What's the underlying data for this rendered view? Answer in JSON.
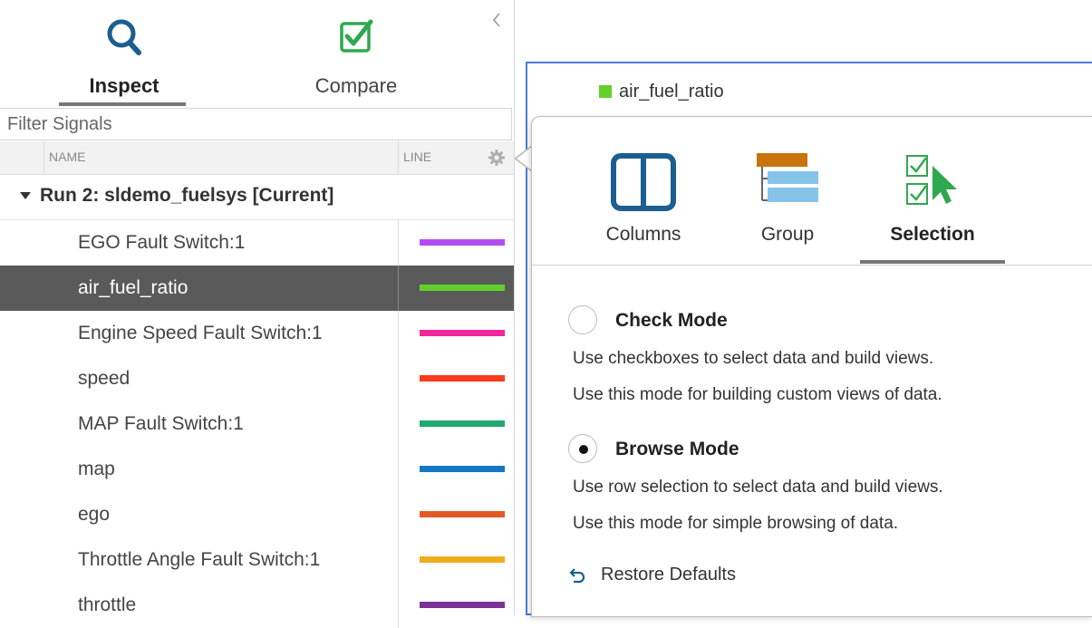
{
  "left_panel": {
    "tabs": [
      {
        "label": "Inspect",
        "icon": "search-icon",
        "active": true
      },
      {
        "label": "Compare",
        "icon": "check-square-icon",
        "active": false
      }
    ],
    "filter": {
      "placeholder": "Filter Signals",
      "value": ""
    },
    "columns": {
      "name": "NAME",
      "line": "LINE"
    },
    "run": {
      "label": "Run 2: sldemo_fuelsys [Current]",
      "expanded": true
    },
    "signals": [
      {
        "name": "EGO Fault Switch:1",
        "color": "#b44cf5",
        "selected": false
      },
      {
        "name": "air_fuel_ratio",
        "color": "#62d02a",
        "selected": true
      },
      {
        "name": "Engine Speed Fault Switch:1",
        "color": "#f0289a",
        "selected": false
      },
      {
        "name": "speed",
        "color": "#fb3c1e",
        "selected": false
      },
      {
        "name": "MAP Fault Switch:1",
        "color": "#21a971",
        "selected": false
      },
      {
        "name": "map",
        "color": "#1577c7",
        "selected": false
      },
      {
        "name": "ego",
        "color": "#e15a26",
        "selected": false
      },
      {
        "name": "Throttle Angle Fault Switch:1",
        "color": "#edad1f",
        "selected": false
      },
      {
        "name": "throttle",
        "color": "#7c3395",
        "selected": false
      }
    ]
  },
  "plot": {
    "legend": {
      "label": "air_fuel_ratio",
      "color": "#62d02a"
    }
  },
  "popup": {
    "tabs": [
      {
        "label": "Columns",
        "icon": "columns-icon",
        "active": false
      },
      {
        "label": "Group",
        "icon": "group-icon",
        "active": false
      },
      {
        "label": "Selection",
        "icon": "selection-icon",
        "active": true
      }
    ],
    "check_mode": {
      "title": "Check Mode",
      "selected": false,
      "desc1": "Use checkboxes to select data and build views.",
      "desc2": "Use this mode for building custom views of data."
    },
    "browse_mode": {
      "title": "Browse Mode",
      "selected": true,
      "desc1": "Use row selection to select data and build views.",
      "desc2": "Use this mode for simple browsing of data."
    },
    "restore_label": "Restore Defaults"
  },
  "colors": {
    "accent_blue": "#1b5e8f",
    "check_green": "#2fa84f",
    "plot_border": "#4a7dde",
    "selected_row": "#5a5a5a"
  }
}
